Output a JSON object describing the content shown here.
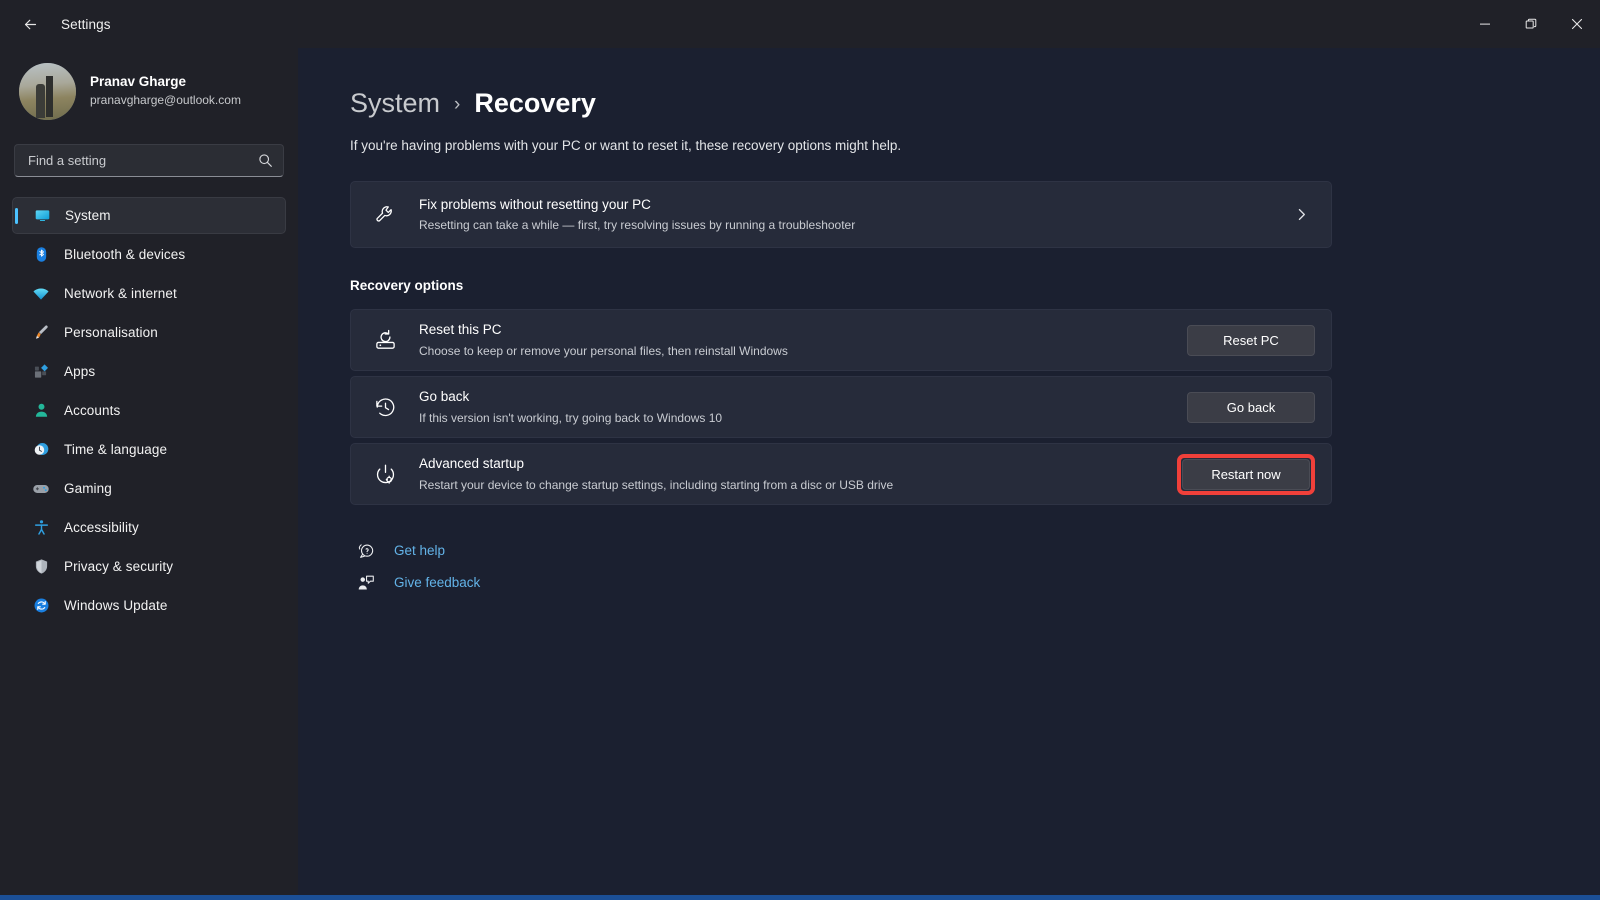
{
  "window": {
    "title": "Settings",
    "back_icon": "arrow-left-icon",
    "controls": {
      "minimize": "—",
      "maximize": "❐",
      "close": "✕"
    }
  },
  "sidebar": {
    "account": {
      "name": "Pranav Gharge",
      "email": "pranavgharge@outlook.com",
      "avatar_icon": "avatar"
    },
    "search": {
      "placeholder": "Find a setting",
      "value": "",
      "icon": "search-icon"
    },
    "items": [
      {
        "label": "System",
        "icon": "monitor-icon",
        "selected": true
      },
      {
        "label": "Bluetooth & devices",
        "icon": "bluetooth-icon",
        "selected": false
      },
      {
        "label": "Network & internet",
        "icon": "wifi-icon",
        "selected": false
      },
      {
        "label": "Personalisation",
        "icon": "paintbrush-icon",
        "selected": false
      },
      {
        "label": "Apps",
        "icon": "apps-icon",
        "selected": false
      },
      {
        "label": "Accounts",
        "icon": "person-icon",
        "selected": false
      },
      {
        "label": "Time & language",
        "icon": "clock-icon",
        "selected": false
      },
      {
        "label": "Gaming",
        "icon": "gamepad-icon",
        "selected": false
      },
      {
        "label": "Accessibility",
        "icon": "accessibility-icon",
        "selected": false
      },
      {
        "label": "Privacy & security",
        "icon": "shield-icon",
        "selected": false
      },
      {
        "label": "Windows Update",
        "icon": "update-icon",
        "selected": false
      }
    ]
  },
  "main": {
    "breadcrumb": {
      "root": "System",
      "separator": "›",
      "current": "Recovery"
    },
    "intro": "If you're having problems with your PC or want to reset it, these recovery options might help.",
    "fix_card": {
      "title": "Fix problems without resetting your PC",
      "subtitle": "Resetting can take a while — first, try resolving issues by running a troubleshooter",
      "icon": "wrench-icon",
      "chevron": "chevron-right-icon"
    },
    "section_heading": "Recovery options",
    "options": [
      {
        "title": "Reset this PC",
        "subtitle": "Choose to keep or remove your personal files, then reinstall Windows",
        "icon": "reset-pc-icon",
        "button": "Reset PC",
        "highlighted": false
      },
      {
        "title": "Go back",
        "subtitle": "If this version isn't working, try going back to Windows 10",
        "icon": "history-icon",
        "button": "Go back",
        "highlighted": false
      },
      {
        "title": "Advanced startup",
        "subtitle": "Restart your device to change startup settings, including starting from a disc or USB drive",
        "icon": "power-icon",
        "button": "Restart now",
        "highlighted": true
      }
    ],
    "links": [
      {
        "label": "Get help",
        "icon": "help-icon"
      },
      {
        "label": "Give feedback",
        "icon": "feedback-icon"
      }
    ]
  },
  "colors": {
    "accent": "#4cc2ff",
    "link": "#63b3e8",
    "highlight": "#f0403a",
    "page_bg": "#1b2030",
    "sidebar_bg": "#202128",
    "card_bg": "#262b3a"
  }
}
